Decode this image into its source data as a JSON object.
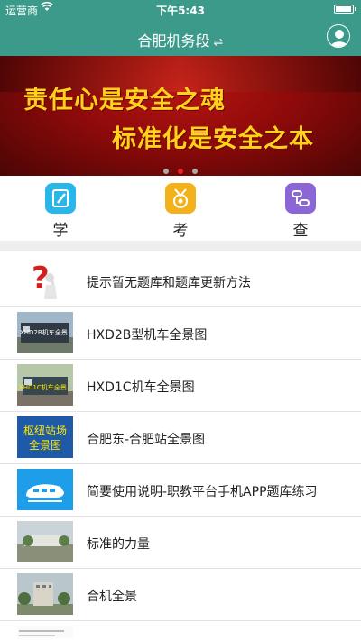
{
  "status_bar": {
    "carrier": "运营商",
    "time": "下午5:43",
    "battery_level": 0.95
  },
  "nav": {
    "title": "合肥机务段",
    "switch_glyph": "⇌",
    "profile_icon": "user-avatar-icon"
  },
  "banner": {
    "line1": "责任心是安全之魂",
    "line2": "标准化是安全之本",
    "slides": 3,
    "active_slide": 2
  },
  "quick_actions": [
    {
      "label": "学",
      "icon": "study-pencil-icon",
      "color": "#29b6e8"
    },
    {
      "label": "考",
      "icon": "exam-medal-icon",
      "color": "#f3b21b"
    },
    {
      "label": "查",
      "icon": "search-flow-icon",
      "color": "#8a66d6"
    }
  ],
  "list": [
    {
      "title": "提示暂无题库和题库更新方法",
      "thumb": "question-mark-figure"
    },
    {
      "title": "HXD2B型机车全景图",
      "thumb": "locomotive-photo",
      "thumb_text": "XHD2B机车全景"
    },
    {
      "title": "HXD1C机车全景图",
      "thumb": "locomotive-photo",
      "thumb_text": "XHD1C机车全景"
    },
    {
      "title": "合肥东-合肥站全景图",
      "thumb": "station-label",
      "thumb_text": "枢纽站场\n全景图"
    },
    {
      "title": "简要使用说明-职教平台手机APP题库练习",
      "thumb": "train-icon"
    },
    {
      "title": "标准的力量",
      "thumb": "depot-photo"
    },
    {
      "title": "合机全景",
      "thumb": "building-photo"
    },
    {
      "title": "",
      "thumb": "document-snippet"
    }
  ]
}
